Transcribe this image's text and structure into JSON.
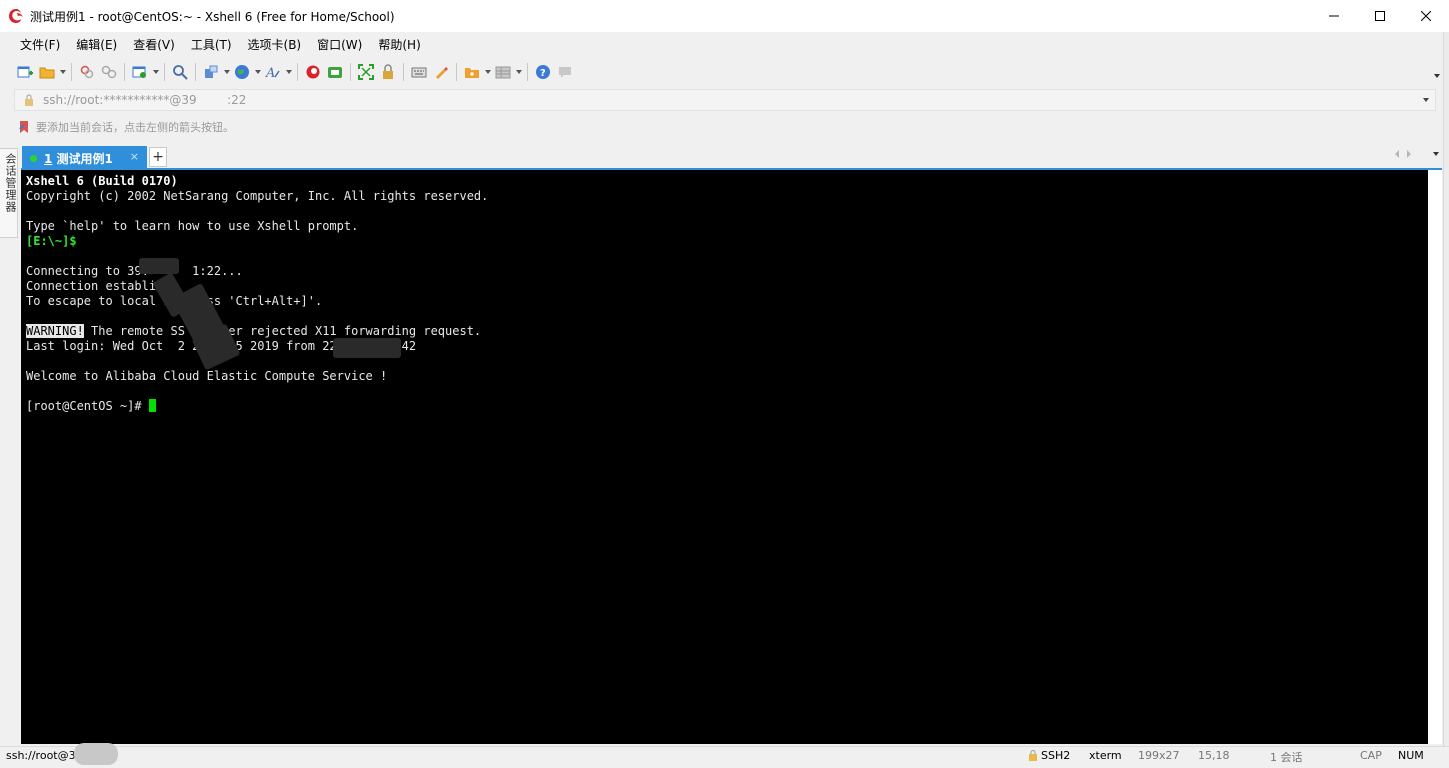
{
  "window": {
    "title": "测试用例1 - root@CentOS:~ - Xshell 6 (Free for Home/School)"
  },
  "menu": [
    {
      "label": "文件(F)"
    },
    {
      "label": "编辑(E)"
    },
    {
      "label": "查看(V)"
    },
    {
      "label": "工具(T)"
    },
    {
      "label": "选项卡(B)"
    },
    {
      "label": "窗口(W)"
    },
    {
      "label": "帮助(H)"
    }
  ],
  "address": {
    "value": "ssh://root:***********@39        :22"
  },
  "hint": {
    "text": "要添加当前会话，点击左侧的箭头按钮。"
  },
  "side_panel": {
    "label": "会话管理器"
  },
  "tab": {
    "number": "1",
    "name": "测试用例1",
    "close": "×",
    "add": "+"
  },
  "terminal": {
    "line1": "Xshell 6 (Build 0170)",
    "line2": "Copyright (c) 2002 NetSarang Computer, Inc. All rights reserved.",
    "line3": "Type `help' to learn how to use Xshell prompt.",
    "line4": "[E:\\~]$",
    "line5": "Connecting to 39.      1:22...",
    "line6": "Connection establi",
    "line7a": "To escape to local s",
    "line7b": "  press 'Ctrl+Alt+]'.",
    "line8_warning": "WARNING!",
    "line8": " The remote SS     ver rejected X11 forwarding request.",
    "line9": "Last login: Wed Oct  2 2     5 2019 from 22         42",
    "line10": "Welcome to Alibaba Cloud Elastic Compute Service !",
    "prompt": "[root@CentOS ~]# "
  },
  "status": {
    "host": "ssh://root@3       :22",
    "protocol": "SSH2",
    "term_type": "xterm",
    "position": "199x27",
    "size": "15,18",
    "sessions": "1 会话",
    "caps": "CAP",
    "num": "NUM"
  },
  "colors": {
    "tab_active": "#2f8fdb",
    "terminal_bg": "#000000",
    "prompt_green": "#2ee62e",
    "cursor": "#00e000"
  }
}
